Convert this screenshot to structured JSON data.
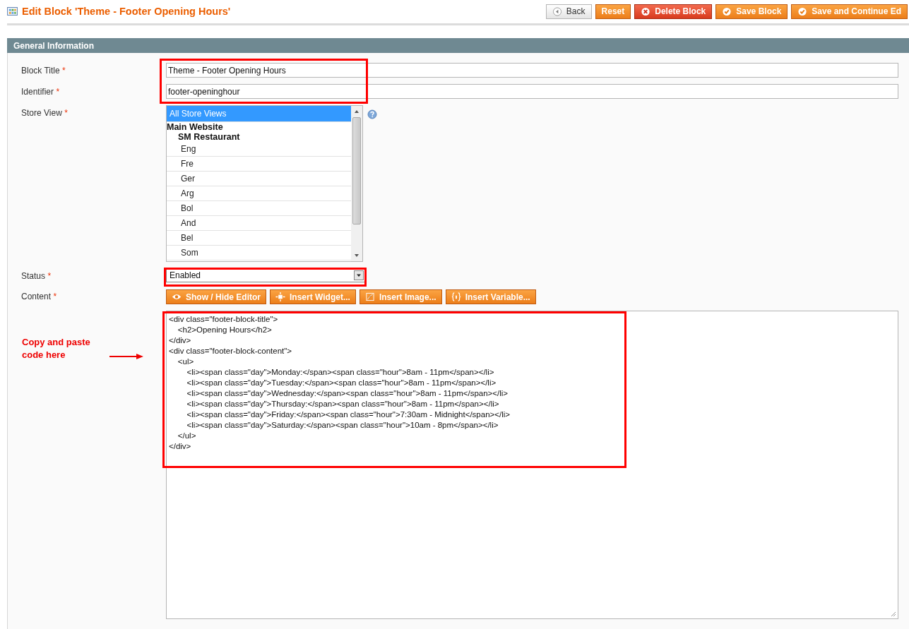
{
  "header": {
    "title": "Edit Block 'Theme - Footer Opening Hours'",
    "buttons": [
      {
        "kind": "back",
        "label": "Back"
      },
      {
        "kind": "plain",
        "label": "Reset"
      },
      {
        "kind": "delete",
        "label": "Delete Block"
      },
      {
        "kind": "save",
        "label": "Save Block"
      },
      {
        "kind": "save",
        "label": "Save and Continue Ed"
      }
    ]
  },
  "section": {
    "title": "General Information"
  },
  "block_title": {
    "label": "Block Title",
    "mark": "*",
    "value": "Theme - Footer Opening Hours"
  },
  "identifier": {
    "label": "Identifier",
    "mark": "*",
    "value": "footer-openinghour"
  },
  "store_view": {
    "label": "Store View",
    "mark": "*",
    "items": [
      {
        "kind": "option",
        "label": "All Store Views",
        "selected": true
      },
      {
        "kind": "group",
        "label": "Main Website",
        "children": [
          {
            "kind": "group",
            "label": "SM Restaurant",
            "children": [
              {
                "kind": "option",
                "label": "Eng",
                "selected": false
              },
              {
                "kind": "option",
                "label": "Fre",
                "selected": false
              },
              {
                "kind": "option",
                "label": "Ger",
                "selected": false
              },
              {
                "kind": "option",
                "label": "Arg",
                "selected": false
              },
              {
                "kind": "option",
                "label": "Bol",
                "selected": false
              },
              {
                "kind": "option",
                "label": "And",
                "selected": false
              },
              {
                "kind": "option",
                "label": "Bel",
                "selected": false
              },
              {
                "kind": "option",
                "label": "Som",
                "selected": false
              }
            ]
          }
        ]
      }
    ]
  },
  "status": {
    "label": "Status",
    "mark": "*",
    "value": "Enabled"
  },
  "content": {
    "label": "Content",
    "mark": "*",
    "buttons": [
      {
        "kind": "eye",
        "label": "Show / Hide Editor"
      },
      {
        "kind": "widget",
        "label": "Insert Widget..."
      },
      {
        "kind": "image",
        "label": "Insert Image..."
      },
      {
        "kind": "variable",
        "label": "Insert Variable..."
      }
    ],
    "lines": [
      "<div class=\"footer-block-title\">",
      "    <h2>Opening Hours</h2>",
      "</div>",
      "<div class=\"footer-block-content\">",
      "    <ul>",
      "        <li><span class=\"day\">Monday:</span><span class=\"hour\">8am - 11pm</span></li>",
      "        <li><span class=\"day\">Tuesday:</span><span class=\"hour\">8am - 11pm</span></li>",
      "        <li><span class=\"day\">Wednesday:</span><span class=\"hour\">8am - 11pm</span></li>",
      "        <li><span class=\"day\">Thursday:</span><span class=\"hour\">8am - 11pm</span></li>",
      "        <li><span class=\"day\">Friday:</span><span class=\"hour\">7:30am - Midnight</span></li>",
      "        <li><span class=\"day\">Saturday:</span><span class=\"hour\">10am - 8pm</span></li>",
      "    </ul>",
      "</div>"
    ]
  },
  "annotation": {
    "text": "Copy and paste code here"
  }
}
